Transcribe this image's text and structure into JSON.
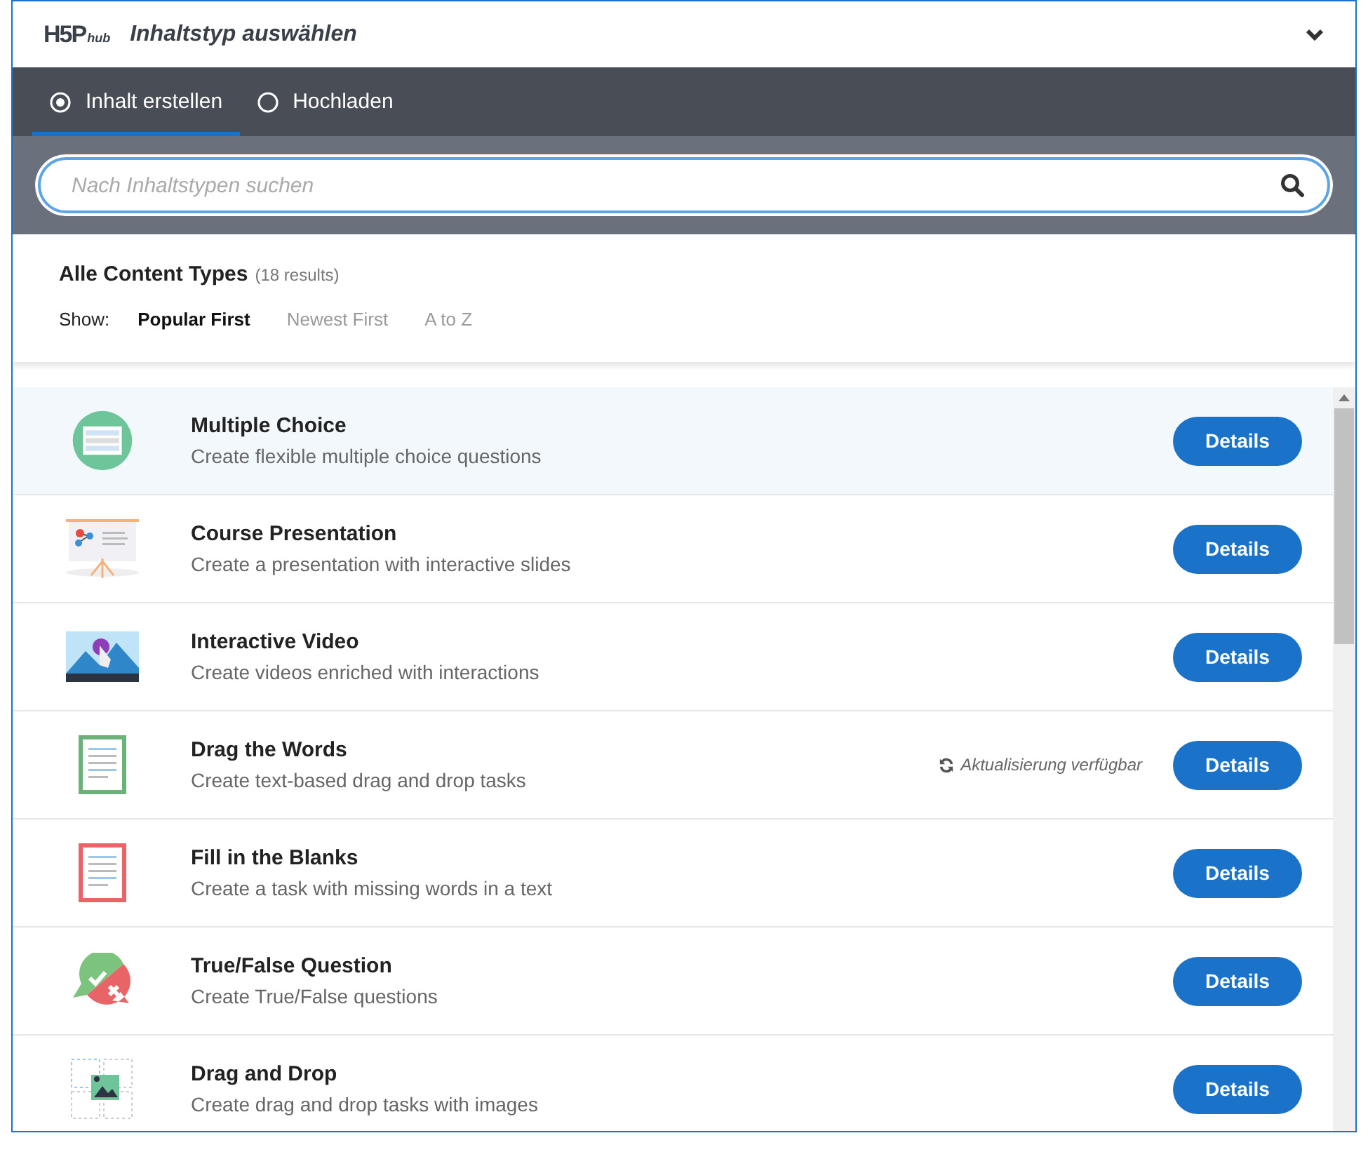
{
  "header": {
    "logo": "H5P",
    "logo_sub": "hub",
    "title": "Inhaltstyp auswählen",
    "expanded": true
  },
  "tabs": [
    {
      "label": "Inhalt erstellen",
      "selected": true
    },
    {
      "label": "Hochladen",
      "selected": false
    }
  ],
  "search": {
    "placeholder": "Nach Inhaltstypen suchen"
  },
  "list_header": {
    "title": "Alle Content Types",
    "count": "(18 results)",
    "show_label": "Show:"
  },
  "sort_options": [
    {
      "label": "Popular First",
      "selected": true
    },
    {
      "label": "Newest First",
      "selected": false
    },
    {
      "label": "A to Z",
      "selected": false
    }
  ],
  "content_types": [
    {
      "kind": "multichoice",
      "title": "Multiple Choice",
      "description": "Create flexible multiple choice questions",
      "button": "Details",
      "selected": true
    },
    {
      "kind": "presentation",
      "title": "Course Presentation",
      "description": "Create a presentation with interactive slides",
      "button": "Details",
      "selected": false
    },
    {
      "kind": "video",
      "title": "Interactive Video",
      "description": "Create videos enriched with interactions",
      "button": "Details",
      "selected": false
    },
    {
      "kind": "dragwords",
      "title": "Drag the Words",
      "description": "Create text-based drag and drop tasks",
      "update": "Aktualisierung verfügbar",
      "button": "Details",
      "selected": false
    },
    {
      "kind": "blanks",
      "title": "Fill in the Blanks",
      "description": "Create a task with missing words in a text",
      "button": "Details",
      "selected": false
    },
    {
      "kind": "truefalse",
      "title": "True/False Question",
      "description": "Create True/False questions",
      "button": "Details",
      "selected": false
    },
    {
      "kind": "dragdrop",
      "title": "Drag and Drop",
      "description": "Create drag and drop tasks with images",
      "button": "Details",
      "selected": false
    }
  ]
}
